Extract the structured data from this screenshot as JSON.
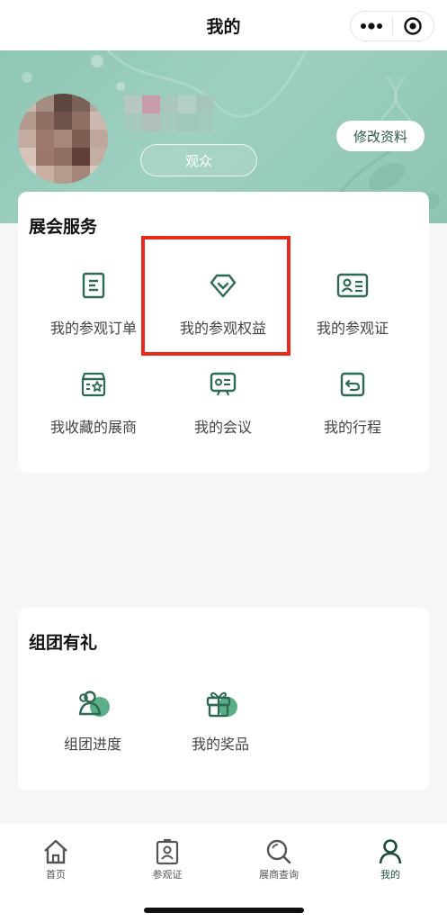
{
  "nav": {
    "title": "我的",
    "more_icon": "more-dots-icon",
    "target_icon": "target-icon"
  },
  "profile": {
    "role_tag": "观众",
    "edit_button": "修改资料"
  },
  "services": {
    "title": "展会服务",
    "items": [
      {
        "label": "我的参观订单",
        "icon": "order-icon"
      },
      {
        "label": "我的参观权益",
        "icon": "diamond-icon"
      },
      {
        "label": "我的参观证",
        "icon": "id-card-icon"
      },
      {
        "label": "我收藏的展商",
        "icon": "store-favorite-icon"
      },
      {
        "label": "我的会议",
        "icon": "meeting-icon"
      },
      {
        "label": "我的行程",
        "icon": "itinerary-icon"
      }
    ]
  },
  "group": {
    "title": "组团有礼",
    "items": [
      {
        "label": "组团进度",
        "icon": "group-icon"
      },
      {
        "label": "我的奖品",
        "icon": "gift-icon"
      }
    ]
  },
  "tabbar": {
    "items": [
      {
        "label": "首页",
        "icon": "home-icon"
      },
      {
        "label": "参观证",
        "icon": "badge-icon"
      },
      {
        "label": "展商查询",
        "icon": "search-icon"
      },
      {
        "label": "我的",
        "icon": "person-icon"
      }
    ],
    "active_index": 3
  },
  "colors": {
    "accent": "#2c6b52",
    "highlight": "#e8291c",
    "banner": "#9ed0c0"
  }
}
